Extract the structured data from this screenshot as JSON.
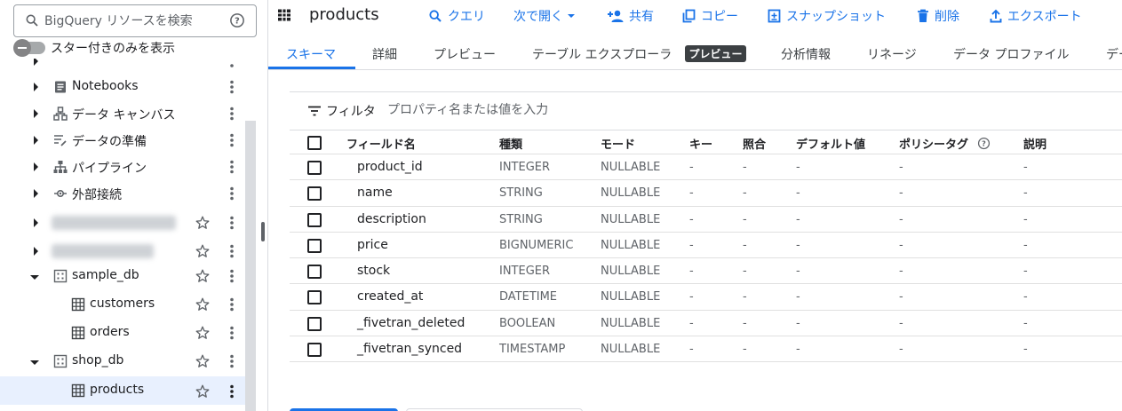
{
  "search": {
    "placeholder": "BigQuery リソースを検索"
  },
  "star_toggle": {
    "label": "スター付きのみを表示",
    "on": false
  },
  "tree": {
    "items": [
      {
        "label": "Notebooks",
        "icon": "notebook-icon"
      },
      {
        "label": "データ キャンバス",
        "icon": "canvas-icon"
      },
      {
        "label": "データの準備",
        "icon": "data-prep-icon"
      },
      {
        "label": "パイプライン",
        "icon": "pipeline-icon"
      },
      {
        "label": "外部接続",
        "icon": "connection-icon"
      }
    ],
    "datasets": [
      {
        "label": "sample_db",
        "icon": "dataset-icon",
        "children": [
          {
            "label": "customers",
            "icon": "table-icon"
          },
          {
            "label": "orders",
            "icon": "table-icon"
          }
        ]
      },
      {
        "label": "shop_db",
        "icon": "dataset-icon",
        "children": [
          {
            "label": "products",
            "icon": "table-icon",
            "selected": true
          }
        ]
      }
    ]
  },
  "toolbar": {
    "title": "products",
    "query": "クエリ",
    "open_next": "次で開く",
    "share": "共有",
    "copy": "コピー",
    "snapshot": "スナップショット",
    "delete": "削除",
    "export": "エクスポート"
  },
  "tabs": {
    "schema": "スキーマ",
    "details": "詳細",
    "preview": "プレビュー",
    "table_explorer": "テーブル エクスプローラ",
    "preview_badge": "プレビュー",
    "insights": "分析情報",
    "lineage": "リネージ",
    "data_profile": "データ プロファイル",
    "overflow": "デー"
  },
  "filter": {
    "label": "フィルタ",
    "placeholder": "プロパティ名または値を入力"
  },
  "schema": {
    "headers": {
      "field": "フィールド名",
      "type": "種類",
      "mode": "モード",
      "key": "キー",
      "collation": "照合",
      "default": "デフォルト値",
      "policy": "ポリシータグ",
      "description": "説明"
    },
    "rows": [
      {
        "name": "product_id",
        "type": "INTEGER",
        "mode": "NULLABLE",
        "key": "-",
        "collation": "-",
        "default": "-",
        "policy": "-",
        "description": "-"
      },
      {
        "name": "name",
        "type": "STRING",
        "mode": "NULLABLE",
        "key": "-",
        "collation": "-",
        "default": "-",
        "policy": "-",
        "description": "-"
      },
      {
        "name": "description",
        "type": "STRING",
        "mode": "NULLABLE",
        "key": "-",
        "collation": "-",
        "default": "-",
        "policy": "-",
        "description": "-"
      },
      {
        "name": "price",
        "type": "BIGNUMERIC",
        "mode": "NULLABLE",
        "key": "-",
        "collation": "-",
        "default": "-",
        "policy": "-",
        "description": "-"
      },
      {
        "name": "stock",
        "type": "INTEGER",
        "mode": "NULLABLE",
        "key": "-",
        "collation": "-",
        "default": "-",
        "policy": "-",
        "description": "-"
      },
      {
        "name": "created_at",
        "type": "DATETIME",
        "mode": "NULLABLE",
        "key": "-",
        "collation": "-",
        "default": "-",
        "policy": "-",
        "description": "-"
      },
      {
        "name": "_fivetran_deleted",
        "type": "BOOLEAN",
        "mode": "NULLABLE",
        "key": "-",
        "collation": "-",
        "default": "-",
        "policy": "-",
        "description": "-"
      },
      {
        "name": "_fivetran_synced",
        "type": "TIMESTAMP",
        "mode": "NULLABLE",
        "key": "-",
        "collation": "-",
        "default": "-",
        "policy": "-",
        "description": "-"
      }
    ]
  },
  "colors": {
    "accent": "#1a73e8",
    "selected_row": "#e8f0fe",
    "badge": "#3c4043"
  }
}
